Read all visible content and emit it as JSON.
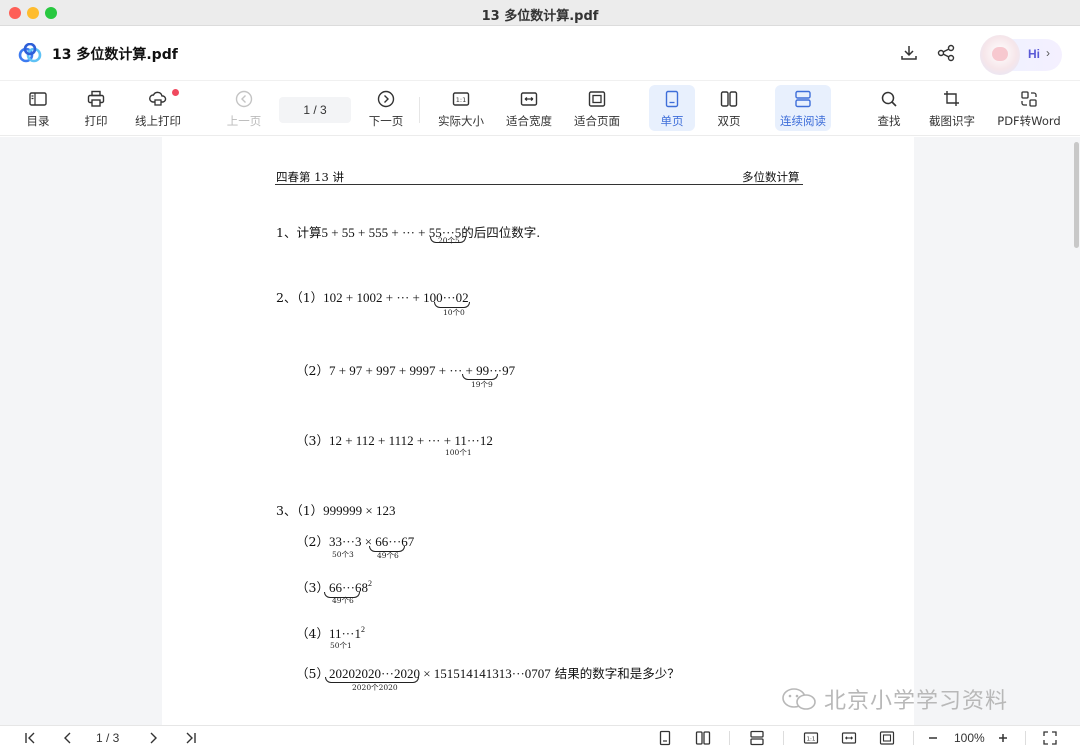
{
  "window": {
    "title": "13 多位数计算.pdf"
  },
  "header": {
    "doc_name": "13 多位数计算.pdf",
    "assistant_label": "Hi",
    "assistant_chevron": "›"
  },
  "toolbar": {
    "toc": "目录",
    "print": "打印",
    "online_print": "线上打印",
    "prev_page": "上一页",
    "page_indicator": "1  /  3",
    "next_page": "下一页",
    "actual_size": "实际大小",
    "fit_width": "适合宽度",
    "fit_page": "适合页面",
    "single_page": "单页",
    "double_page": "双页",
    "continuous": "连续阅读",
    "search": "查找",
    "ocr": "截图识字",
    "pdf_to_word": "PDF转Word"
  },
  "document": {
    "header_left": "四春第 13 讲",
    "header_right": "多位数计算",
    "q1_prefix": "1、计算",
    "q1_expr": "5 + 55 + 555 + ··· + ",
    "q1_brace": "55···5",
    "q1_sub": "20个5",
    "q1_suffix": "的后四位数字.",
    "q2_1_label": "2、（1）",
    "q2_1_expr": "102 + 1002 + ··· + 1",
    "q2_1_brace": "00···0",
    "q2_1_tail": "2",
    "q2_1_sub": "10个0",
    "q2_2_label": "（2）",
    "q2_2_expr": "7 + 97 + 997 + 9997 + ··· + ",
    "q2_2_brace": "99···9",
    "q2_2_tail": "7",
    "q2_2_sub": "19个9",
    "q2_3_label": "（3）",
    "q2_3_expr": "12 + 112 + 1112 + ··· + 11···12",
    "q2_3_sub": "100个1",
    "q3_1_label": "3、（1）",
    "q3_1_expr": "999999 × 123",
    "q3_2_label": "（2）",
    "q3_2_a": "33···3",
    "q3_2_mid": " × ",
    "q3_2_b": "66···6",
    "q3_2_tail": "7",
    "q3_2_sub_a": "50个3",
    "q3_2_sub_b": "49个6",
    "q3_3_label": "（3）",
    "q3_3_brace": "66···6",
    "q3_3_tail": "8",
    "q3_3_sup": "2",
    "q3_3_sub": "49个6",
    "q3_4_label": "（4）",
    "q3_4_expr": "11···1",
    "q3_4_sup": "2",
    "q3_4_sub": "50个1",
    "q3_5_label": "（5）",
    "q3_5_brace": "20202020···2020",
    "q3_5_expr": " × 151514141313···0707",
    "q3_5_suffix": " 结果的数字和是多少？",
    "q3_5_sub": "2020个2020"
  },
  "watermark": "北京小学学习资料",
  "statusbar": {
    "page_indicator": "1  /  3",
    "zoom": "100%"
  }
}
